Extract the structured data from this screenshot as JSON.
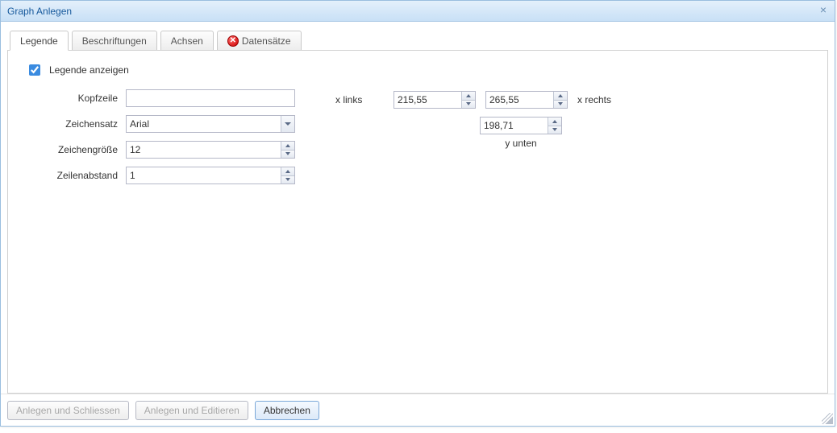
{
  "window": {
    "title": "Graph Anlegen"
  },
  "tabs": [
    {
      "label": "Legende",
      "hasError": false
    },
    {
      "label": "Beschriftungen",
      "hasError": false
    },
    {
      "label": "Achsen",
      "hasError": false
    },
    {
      "label": "Datensätze",
      "hasError": true
    }
  ],
  "legendTab": {
    "showLegendLabel": "Legende anzeigen",
    "showLegendChecked": true,
    "fields": {
      "kopfzeile": {
        "label": "Kopfzeile",
        "value": ""
      },
      "zeichensatz": {
        "label": "Zeichensatz",
        "value": "Arial"
      },
      "zeichengroesse": {
        "label": "Zeichengröße",
        "value": "12"
      },
      "zeilenabstand": {
        "label": "Zeilenabstand",
        "value": "1"
      }
    },
    "position": {
      "xlinksLabel": "x links",
      "xrechtsLabel": "x rechts",
      "yuntenLabel": "y unten",
      "xlinks": "215,55",
      "xrechts": "265,55",
      "yunten": "198,71"
    }
  },
  "footer": {
    "anlegenSchliessen": "Anlegen und Schliessen",
    "anlegenEditieren": "Anlegen und Editieren",
    "abbrechen": "Abbrechen"
  }
}
